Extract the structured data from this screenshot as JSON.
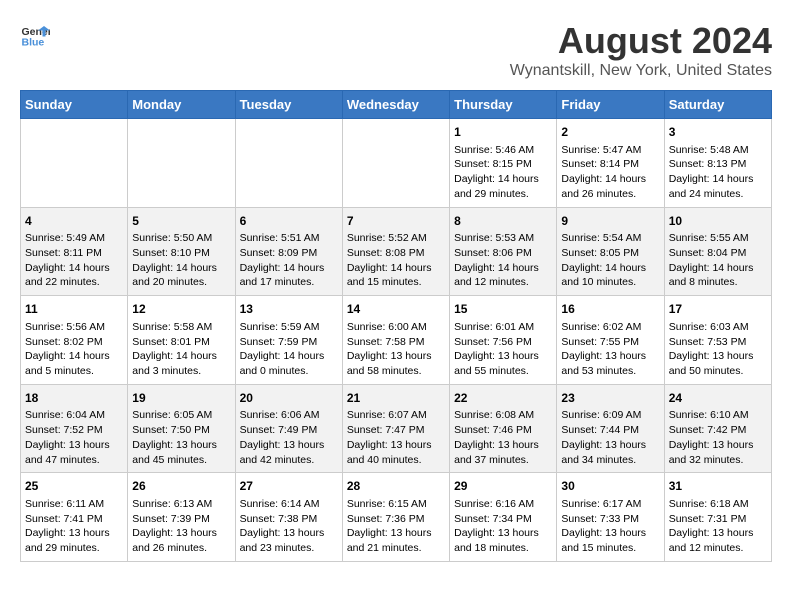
{
  "header": {
    "logo_line1": "General",
    "logo_line2": "Blue",
    "title": "August 2024",
    "subtitle": "Wynantskill, New York, United States"
  },
  "days_of_week": [
    "Sunday",
    "Monday",
    "Tuesday",
    "Wednesday",
    "Thursday",
    "Friday",
    "Saturday"
  ],
  "weeks": [
    [
      {
        "day": "",
        "info": ""
      },
      {
        "day": "",
        "info": ""
      },
      {
        "day": "",
        "info": ""
      },
      {
        "day": "",
        "info": ""
      },
      {
        "day": "1",
        "info": "Sunrise: 5:46 AM\nSunset: 8:15 PM\nDaylight: 14 hours\nand 29 minutes."
      },
      {
        "day": "2",
        "info": "Sunrise: 5:47 AM\nSunset: 8:14 PM\nDaylight: 14 hours\nand 26 minutes."
      },
      {
        "day": "3",
        "info": "Sunrise: 5:48 AM\nSunset: 8:13 PM\nDaylight: 14 hours\nand 24 minutes."
      }
    ],
    [
      {
        "day": "4",
        "info": "Sunrise: 5:49 AM\nSunset: 8:11 PM\nDaylight: 14 hours\nand 22 minutes."
      },
      {
        "day": "5",
        "info": "Sunrise: 5:50 AM\nSunset: 8:10 PM\nDaylight: 14 hours\nand 20 minutes."
      },
      {
        "day": "6",
        "info": "Sunrise: 5:51 AM\nSunset: 8:09 PM\nDaylight: 14 hours\nand 17 minutes."
      },
      {
        "day": "7",
        "info": "Sunrise: 5:52 AM\nSunset: 8:08 PM\nDaylight: 14 hours\nand 15 minutes."
      },
      {
        "day": "8",
        "info": "Sunrise: 5:53 AM\nSunset: 8:06 PM\nDaylight: 14 hours\nand 12 minutes."
      },
      {
        "day": "9",
        "info": "Sunrise: 5:54 AM\nSunset: 8:05 PM\nDaylight: 14 hours\nand 10 minutes."
      },
      {
        "day": "10",
        "info": "Sunrise: 5:55 AM\nSunset: 8:04 PM\nDaylight: 14 hours\nand 8 minutes."
      }
    ],
    [
      {
        "day": "11",
        "info": "Sunrise: 5:56 AM\nSunset: 8:02 PM\nDaylight: 14 hours\nand 5 minutes."
      },
      {
        "day": "12",
        "info": "Sunrise: 5:58 AM\nSunset: 8:01 PM\nDaylight: 14 hours\nand 3 minutes."
      },
      {
        "day": "13",
        "info": "Sunrise: 5:59 AM\nSunset: 7:59 PM\nDaylight: 14 hours\nand 0 minutes."
      },
      {
        "day": "14",
        "info": "Sunrise: 6:00 AM\nSunset: 7:58 PM\nDaylight: 13 hours\nand 58 minutes."
      },
      {
        "day": "15",
        "info": "Sunrise: 6:01 AM\nSunset: 7:56 PM\nDaylight: 13 hours\nand 55 minutes."
      },
      {
        "day": "16",
        "info": "Sunrise: 6:02 AM\nSunset: 7:55 PM\nDaylight: 13 hours\nand 53 minutes."
      },
      {
        "day": "17",
        "info": "Sunrise: 6:03 AM\nSunset: 7:53 PM\nDaylight: 13 hours\nand 50 minutes."
      }
    ],
    [
      {
        "day": "18",
        "info": "Sunrise: 6:04 AM\nSunset: 7:52 PM\nDaylight: 13 hours\nand 47 minutes."
      },
      {
        "day": "19",
        "info": "Sunrise: 6:05 AM\nSunset: 7:50 PM\nDaylight: 13 hours\nand 45 minutes."
      },
      {
        "day": "20",
        "info": "Sunrise: 6:06 AM\nSunset: 7:49 PM\nDaylight: 13 hours\nand 42 minutes."
      },
      {
        "day": "21",
        "info": "Sunrise: 6:07 AM\nSunset: 7:47 PM\nDaylight: 13 hours\nand 40 minutes."
      },
      {
        "day": "22",
        "info": "Sunrise: 6:08 AM\nSunset: 7:46 PM\nDaylight: 13 hours\nand 37 minutes."
      },
      {
        "day": "23",
        "info": "Sunrise: 6:09 AM\nSunset: 7:44 PM\nDaylight: 13 hours\nand 34 minutes."
      },
      {
        "day": "24",
        "info": "Sunrise: 6:10 AM\nSunset: 7:42 PM\nDaylight: 13 hours\nand 32 minutes."
      }
    ],
    [
      {
        "day": "25",
        "info": "Sunrise: 6:11 AM\nSunset: 7:41 PM\nDaylight: 13 hours\nand 29 minutes."
      },
      {
        "day": "26",
        "info": "Sunrise: 6:13 AM\nSunset: 7:39 PM\nDaylight: 13 hours\nand 26 minutes."
      },
      {
        "day": "27",
        "info": "Sunrise: 6:14 AM\nSunset: 7:38 PM\nDaylight: 13 hours\nand 23 minutes."
      },
      {
        "day": "28",
        "info": "Sunrise: 6:15 AM\nSunset: 7:36 PM\nDaylight: 13 hours\nand 21 minutes."
      },
      {
        "day": "29",
        "info": "Sunrise: 6:16 AM\nSunset: 7:34 PM\nDaylight: 13 hours\nand 18 minutes."
      },
      {
        "day": "30",
        "info": "Sunrise: 6:17 AM\nSunset: 7:33 PM\nDaylight: 13 hours\nand 15 minutes."
      },
      {
        "day": "31",
        "info": "Sunrise: 6:18 AM\nSunset: 7:31 PM\nDaylight: 13 hours\nand 12 minutes."
      }
    ]
  ]
}
